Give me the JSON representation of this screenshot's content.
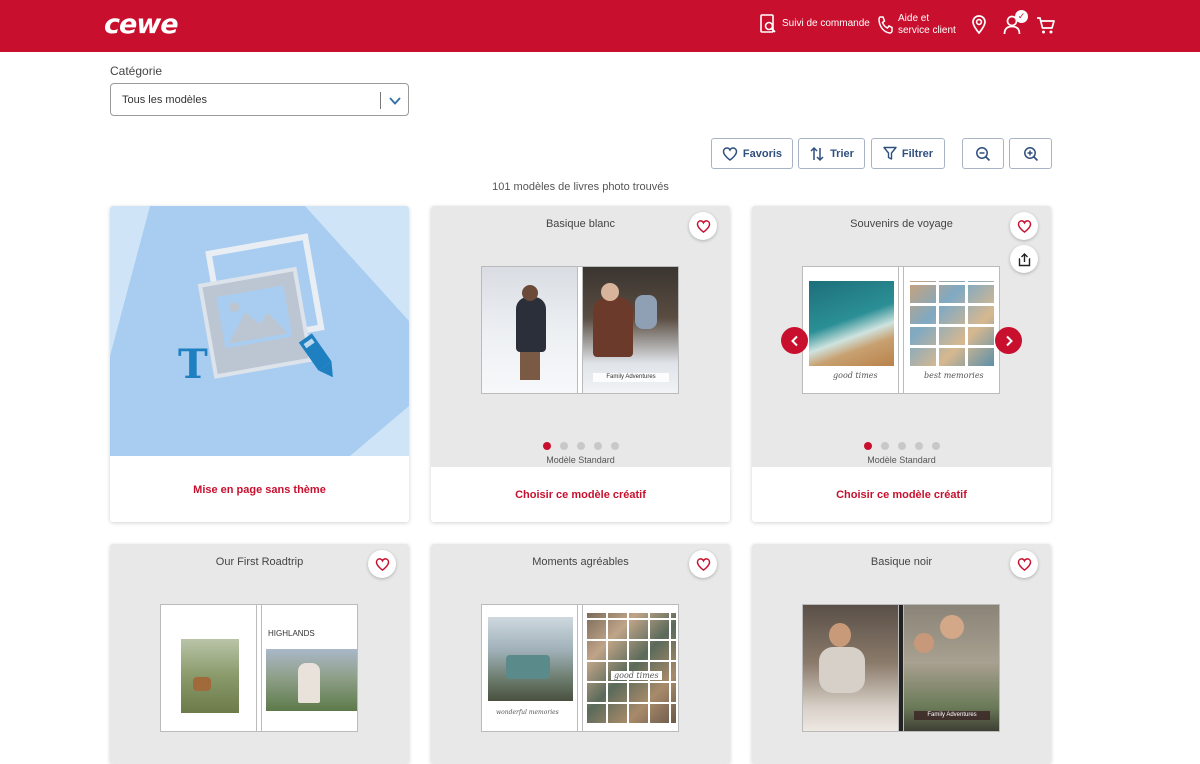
{
  "header": {
    "logo": "cewe",
    "order_tracking": [
      "Suivi de commande"
    ],
    "help": [
      "Aide et",
      "service client"
    ],
    "icons": [
      "order-tracking-icon",
      "phone-icon",
      "location-icon",
      "user-icon",
      "cart-icon"
    ]
  },
  "filters": {
    "category_label": "Catégorie",
    "category_value": "Tous les modèles",
    "favorites_label": "Favoris",
    "sort_label": "Trier",
    "filter_label": "Filtrer"
  },
  "results": {
    "count_text": "101 modèles de livres photo trouvés"
  },
  "cards": [
    {
      "title": "",
      "cta": "Mise en page sans thème"
    },
    {
      "title": "Basique blanc",
      "subtitle": "Modèle Standard",
      "cta": "Choisir ce modèle créatif",
      "cover_caption": "Family Adventures",
      "dots": 5,
      "active_dot": 0
    },
    {
      "title": "Souvenirs de voyage",
      "subtitle": "Modèle Standard",
      "cta": "Choisir ce modèle créatif",
      "script_left": "good times",
      "script_right": "best memories",
      "dots": 5,
      "active_dot": 0
    },
    {
      "title": "Our First Roadtrip",
      "cover_title": "HIGHLANDS"
    },
    {
      "title": "Moments agréables",
      "script_right": "good times",
      "script_left": "wonderful memories"
    },
    {
      "title": "Basique noir",
      "cover_caption": "Family Adventures"
    }
  ],
  "colors": {
    "brand": "#c8102e",
    "button_text": "#2f4f7f",
    "card_bg": "#e8e8e8"
  }
}
